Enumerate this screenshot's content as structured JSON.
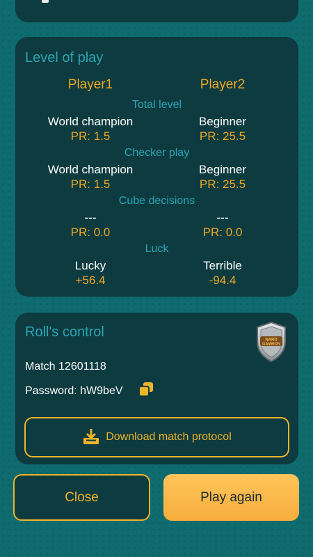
{
  "level_of_play": {
    "title": "Level of play",
    "player1": "Player1",
    "player2": "Player2",
    "sections": [
      {
        "label": "Total level",
        "p1_level": "World champion",
        "p1_pr": "PR: 1.5",
        "p2_level": "Beginner",
        "p2_pr": "PR: 25.5"
      },
      {
        "label": "Checker play",
        "p1_level": "World champion",
        "p1_pr": "PR: 1.5",
        "p2_level": "Beginner",
        "p2_pr": "PR: 25.5"
      },
      {
        "label": "Cube decisions",
        "p1_level": "---",
        "p1_pr": "PR: 0.0",
        "p2_level": "---",
        "p2_pr": "PR: 0.0"
      },
      {
        "label": "Luck",
        "p1_level": "Lucky",
        "p1_pr": "+56.4",
        "p2_level": "Terrible",
        "p2_pr": "-94.4"
      }
    ]
  },
  "rolls_control": {
    "title": "Roll's control",
    "match": "Match 12601118",
    "password": "Password: hW9beV",
    "download_label": "Download match protocol",
    "badge_text": "NARD GAMMON"
  },
  "buttons": {
    "close": "Close",
    "play_again": "Play again"
  },
  "colors": {
    "background": "#0e6b6e",
    "card": "#0d3b40",
    "accent_yellow": "#f0a820",
    "accent_teal": "#2aa6b5"
  }
}
